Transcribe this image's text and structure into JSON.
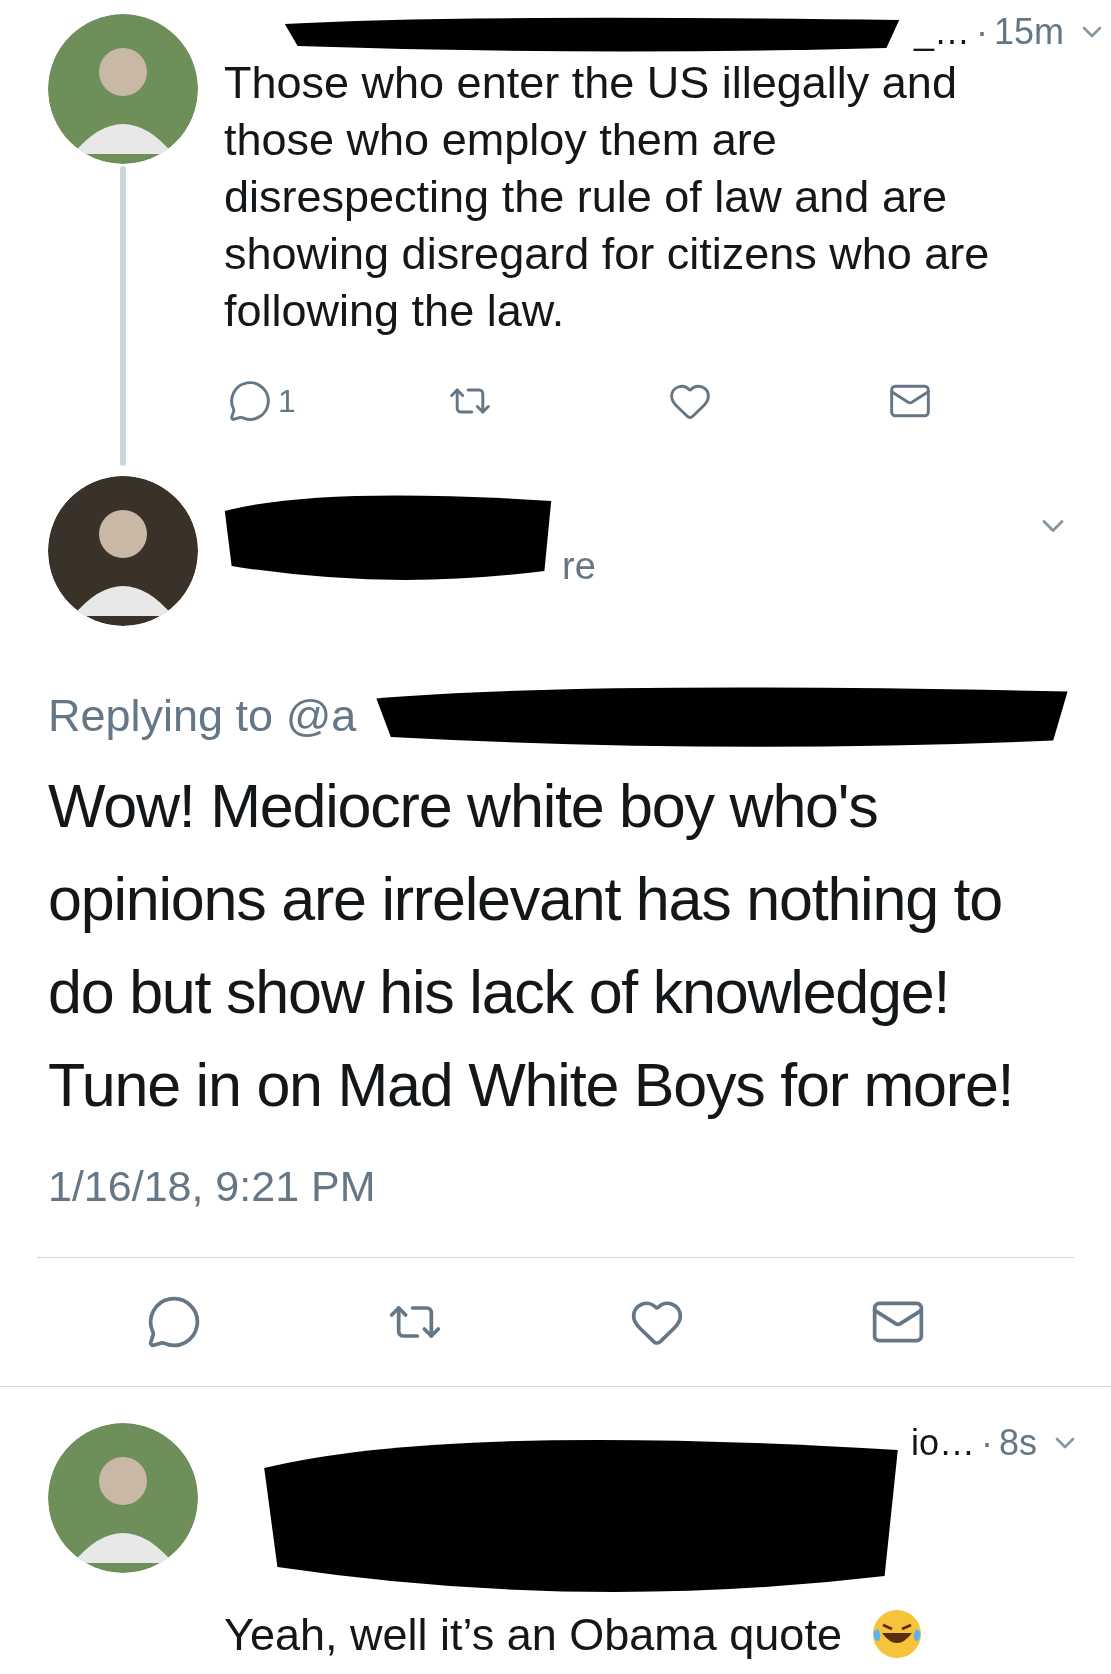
{
  "parent_tweet": {
    "header_tail": "_…",
    "separator": "·",
    "time": "15m",
    "text_lines": [
      "Those who enter the US illegally and",
      "those who employ them are",
      "disrespecting the rule of law and are",
      "showing disregard for citizens who are",
      "following the law."
    ],
    "actions": [
      {
        "kind": "reply",
        "count": "1"
      },
      {
        "kind": "retweet"
      },
      {
        "kind": "like"
      },
      {
        "kind": "message"
      }
    ]
  },
  "focused_tweet": {
    "handle_fragment": "re",
    "replying_to": "Replying to @a",
    "text_lines": [
      "Wow! Mediocre white boy who's",
      "opinions are irrelevant has nothing to",
      "do but show his lack of knowledge!",
      "Tune in on Mad White Boys for more!"
    ],
    "timestamp": "1/16/18, 9:21 PM",
    "actions": [
      {
        "kind": "reply"
      },
      {
        "kind": "retweet"
      },
      {
        "kind": "like"
      },
      {
        "kind": "message"
      }
    ]
  },
  "reply_tweet": {
    "header_tail": "io…",
    "separator": "·",
    "time": "8s",
    "text": "Yeah, well it’s an Obama quote"
  }
}
